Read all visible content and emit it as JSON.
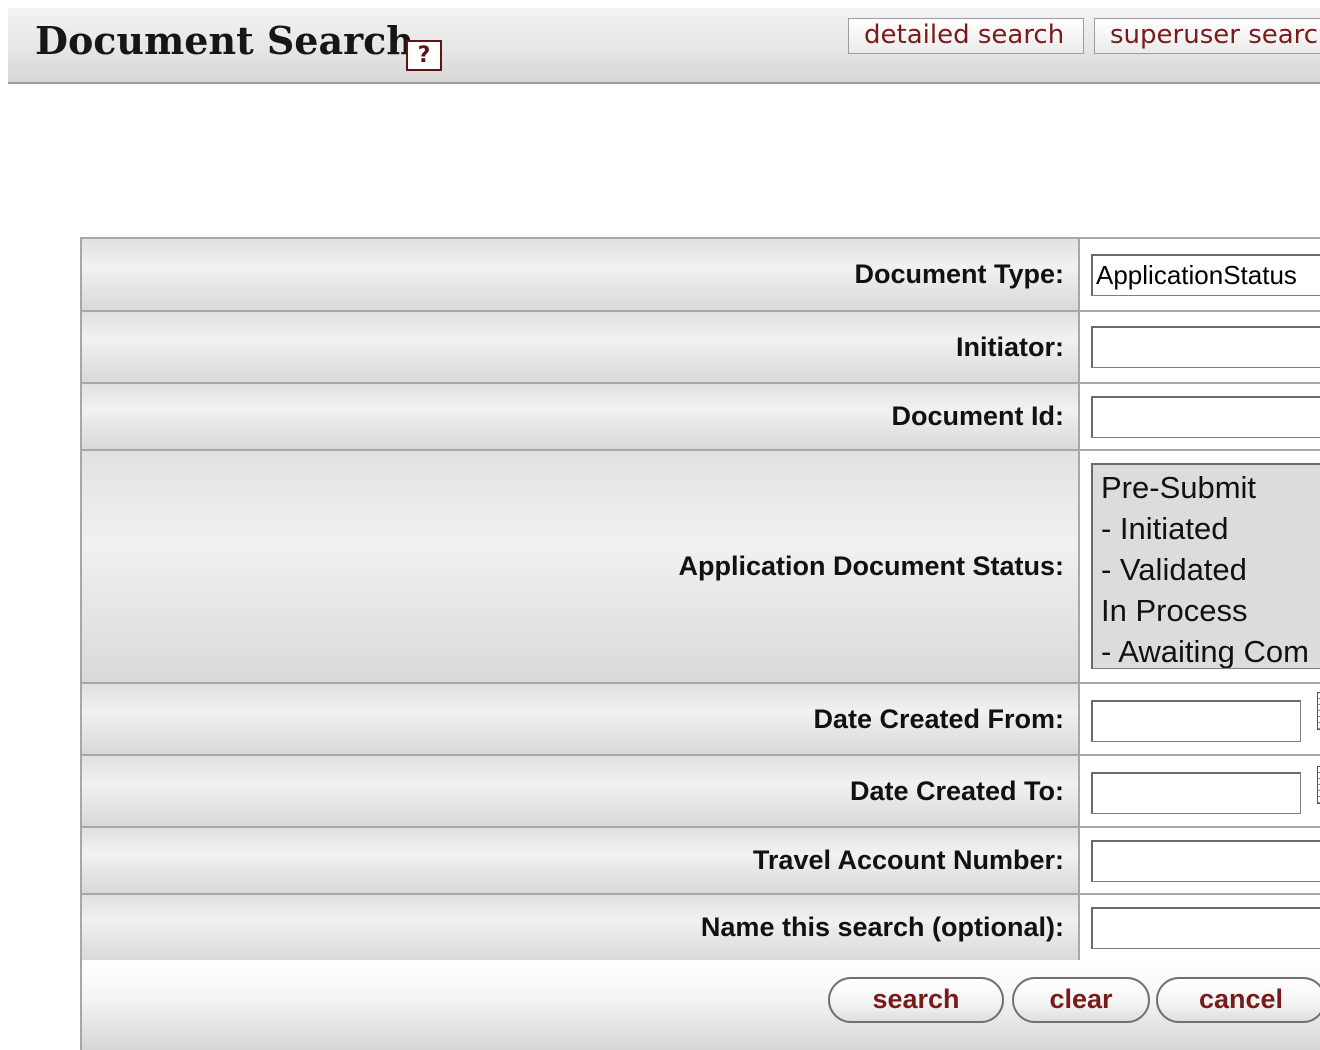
{
  "header": {
    "title": "Document Search",
    "help_icon": "help-question-icon",
    "help_label": "?",
    "detailed_search_label": "detailed search",
    "superuser_search_label": "superuser search"
  },
  "form": {
    "document_type": {
      "label": "Document Type:",
      "value": "ApplicationStatus"
    },
    "initiator": {
      "label": "Initiator:",
      "value": ""
    },
    "document_id": {
      "label": "Document Id:",
      "value": ""
    },
    "application_document_status": {
      "label": "Application Document Status:",
      "options": [
        "Pre-Submit",
        "- Initiated",
        "- Validated",
        "In Process",
        "- Awaiting Com"
      ]
    },
    "date_created_from": {
      "label": "Date Created From:",
      "value": "",
      "icon": "calendar-icon"
    },
    "date_created_to": {
      "label": "Date Created To:",
      "value": "",
      "icon": "calendar-icon"
    },
    "travel_account_number": {
      "label": "Travel Account Number:",
      "value": ""
    },
    "search_name": {
      "label": "Name this search (optional):",
      "value": ""
    }
  },
  "actions": {
    "search_label": "search",
    "clear_label": "clear",
    "cancel_label": "cancel"
  },
  "colors": {
    "button_text": "#7a1a1a",
    "border": "#a7a7a7",
    "label_background": "#e1e1e1"
  }
}
